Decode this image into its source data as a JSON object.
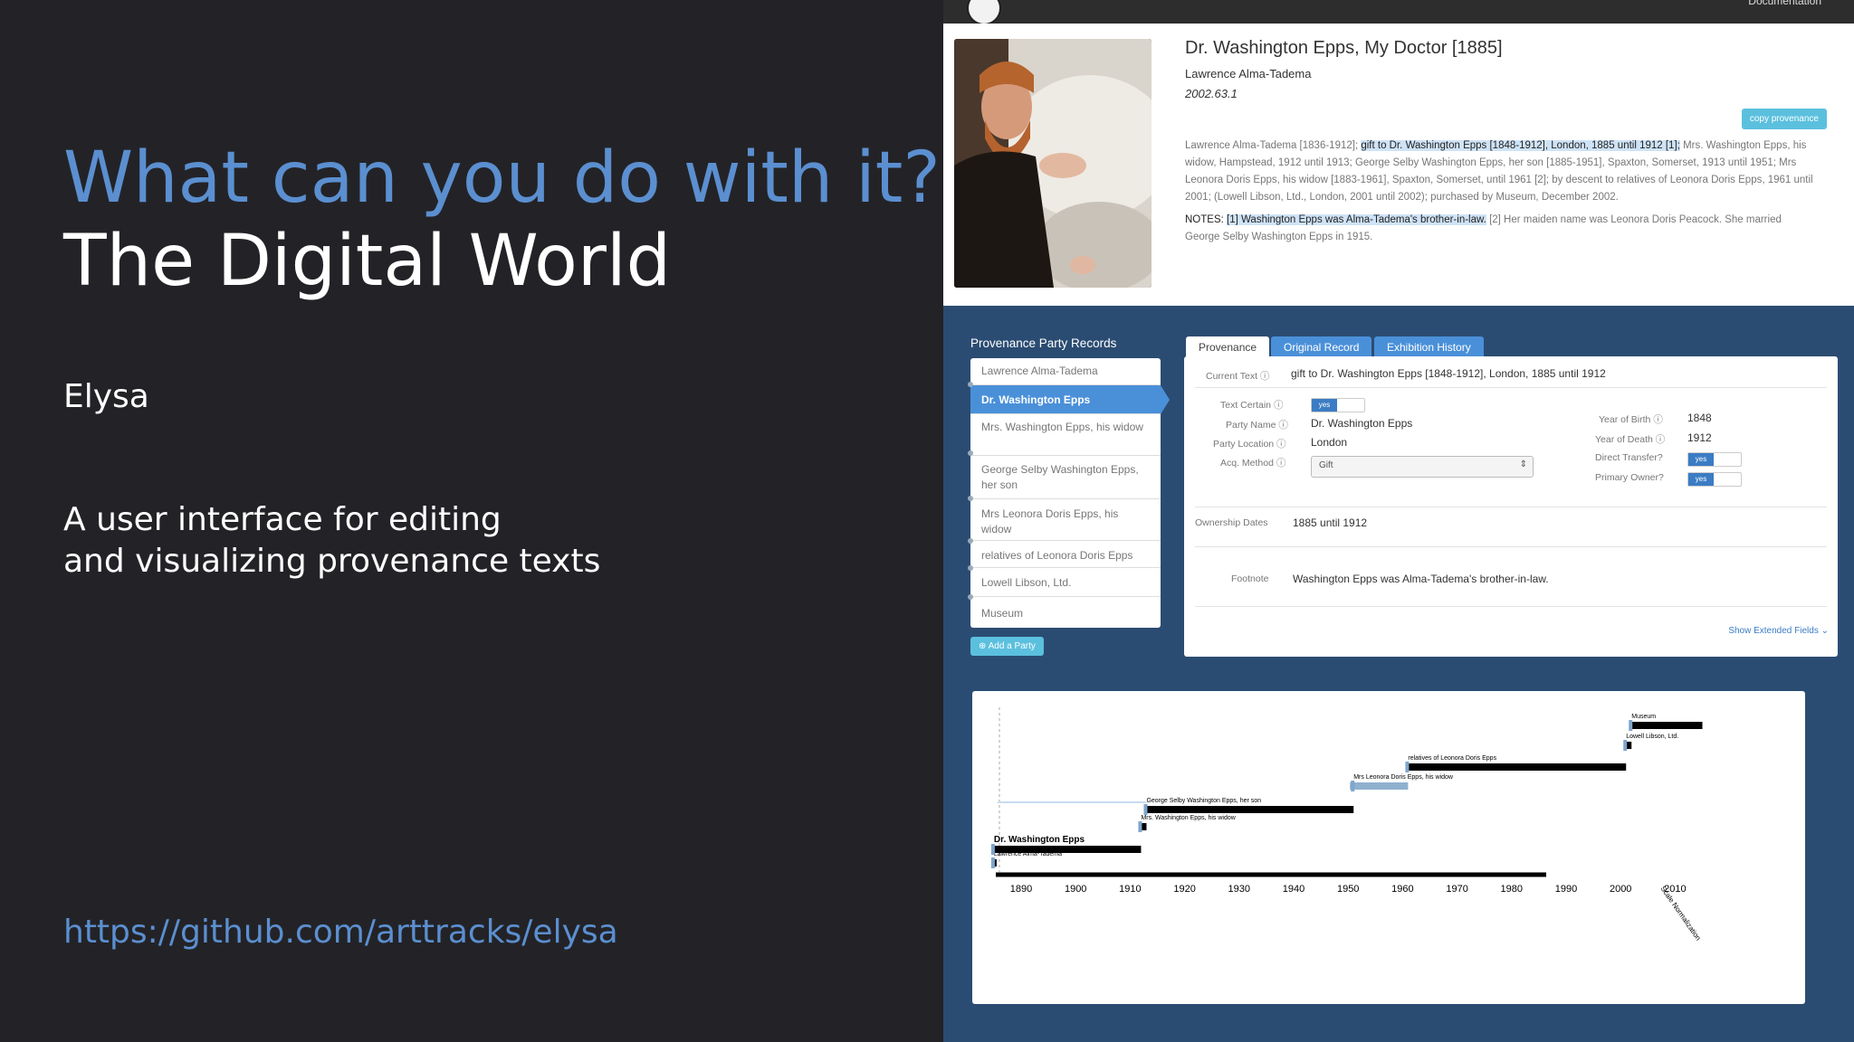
{
  "slide": {
    "question": "What can you do with it?",
    "title": "The Digital World",
    "project": "Elysa",
    "description_line1": "A user interface for editing",
    "description_line2": "and visualizing provenance texts",
    "link": "https://github.com/arttracks/elysa"
  },
  "app": {
    "top_link": "Documentation",
    "artwork": {
      "title": "Dr. Washington Epps, My Doctor [1885]",
      "artist": "Lawrence Alma-Tadema",
      "accession": "2002.63.1"
    },
    "copy_button": "copy provenance",
    "provenance": {
      "pre": "Lawrence Alma-Tadema [1836-1912];",
      "highlight": "gift to Dr. Washington Epps [1848-1912], London, 1885 until 1912 [1];",
      "post": "Mrs. Washington Epps, his widow, Hampstead, 1912 until 1913; George Selby Washington Epps, her son [1885-1951], Spaxton, Somerset, 1913 until 1951; Mrs Leonora Doris Epps, his widow [1883-1961], Spaxton, Somerset, until 1961 [2]; by descent to relatives of Leonora Doris Epps, 1961 until 2001; (Lowell Libson, Ltd., London, 2001 until 2002); purchased by Museum, December 2002."
    },
    "notes": {
      "label": "NOTES:",
      "highlight": "[1] Washington Epps was Alma-Tadema's brother-in-law.",
      "rest": "[2] Her maiden name was Leonora Doris Peacock. She married George Selby Washington Epps in 1915."
    },
    "party_records": {
      "heading": "Provenance Party Records",
      "items": [
        "Lawrence Alma-Tadema",
        "Dr. Washington Epps",
        "Mrs. Washington Epps, his widow",
        "George Selby Washington Epps, her son",
        "Mrs Leonora Doris Epps, his widow",
        "relatives of Leonora Doris Epps",
        "Lowell Libson, Ltd.",
        "Museum"
      ],
      "add_button": "Add a Party"
    },
    "tabs": [
      "Provenance",
      "Original Record",
      "Exhibition History"
    ],
    "form": {
      "current_text_label": "Current Text",
      "current_text": "gift to Dr. Washington Epps [1848-1912], London, 1885 until 1912",
      "text_certain_label": "Text Certain",
      "yes": "yes",
      "party_name_label": "Party Name",
      "party_name": "Dr. Washington Epps",
      "party_location_label": "Party Location",
      "party_location": "London",
      "acq_method_label": "Acq. Method",
      "acq_method": "Gift",
      "year_birth_label": "Year of Birth",
      "year_birth": "1848",
      "year_death_label": "Year of Death",
      "year_death": "1912",
      "direct_transfer_label": "Direct Transfer?",
      "primary_owner_label": "Primary Owner?",
      "ownership_label": "Ownership Dates",
      "ownership": "1885 until 1912",
      "footnote_label": "Footnote",
      "footnote": "Washington Epps was Alma-Tadema's brother-in-law.",
      "extended": "Show Extended Fields"
    },
    "timeline": {
      "axis_years": [
        1890,
        1900,
        1910,
        1920,
        1930,
        1940,
        1950,
        1960,
        1970,
        1980,
        1990,
        2000,
        2010
      ],
      "bars": [
        {
          "label": "Lawrence Alma-Tadema",
          "start": 1885,
          "end": 1885
        },
        {
          "label": "Dr. Washington Epps",
          "start": 1885,
          "end": 1912
        },
        {
          "label": "Mrs. Washington Epps, his widow",
          "start": 1912,
          "end": 1913
        },
        {
          "label": "George Selby Washington Epps, her son",
          "start": 1913,
          "end": 1951
        },
        {
          "label": "Mrs Leonora Doris Epps, his widow",
          "start": 1951,
          "end": 1961
        },
        {
          "label": "relatives of Leonora Doris Epps",
          "start": 1961,
          "end": 2001
        },
        {
          "label": "Lowell Libson, Ltd.",
          "start": 2001,
          "end": 2002
        },
        {
          "label": "Museum",
          "start": 2002,
          "end": 2015
        }
      ],
      "scale_note": "Scale Normalization"
    }
  }
}
